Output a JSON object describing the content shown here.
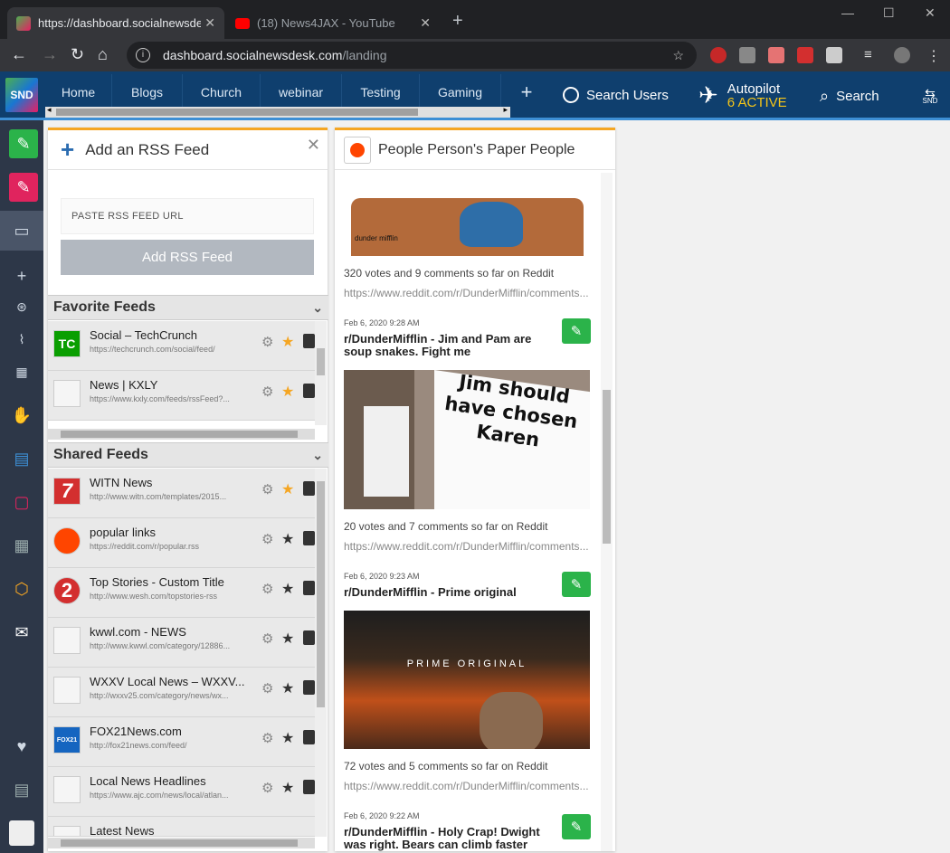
{
  "browser": {
    "tabs": [
      {
        "title": "https://dashboard.socialnewsdesk"
      },
      {
        "title": "(18) News4JAX - YouTube"
      }
    ],
    "url_host": "dashboard.socialnewsdesk.com",
    "url_path": "/landing"
  },
  "app": {
    "logo": "SND",
    "nav_tabs": [
      "Home",
      "Blogs",
      "Church",
      "webinar",
      "Testing",
      "Gaming"
    ],
    "search_users": "Search Users",
    "autopilot": "Autopilot",
    "autopilot_status": "6 ACTIVE",
    "search": "Search",
    "snd_badge": "SND"
  },
  "rss_panel": {
    "title": "Add an RSS Feed",
    "input_placeholder": "PASTE RSS FEED URL",
    "add_button": "Add RSS Feed",
    "favorite_header": "Favorite Feeds",
    "favorites": [
      {
        "title": "Social – TechCrunch",
        "url": "https://techcrunch.com/social/feed/",
        "icon": "TC"
      },
      {
        "title": "News | KXLY",
        "url": "https://www.kxly.com/feeds/rssFeed?..."
      }
    ],
    "shared_header": "Shared Feeds",
    "shared": [
      {
        "title": "WITN News",
        "url": "http://www.witn.com/templates/2015...",
        "icon": "7"
      },
      {
        "title": "popular links",
        "url": "https://reddit.com/r/popular.rss"
      },
      {
        "title": "Top Stories - Custom Title",
        "url": "http://www.wesh.com/topstories-rss",
        "icon": "2"
      },
      {
        "title": "kwwl.com - NEWS",
        "url": "http://www.kwwl.com/category/12886..."
      },
      {
        "title": "WXXV Local News – WXXV...",
        "url": "http://wxxv25.com/category/news/wx..."
      },
      {
        "title": "FOX21News.com",
        "url": "http://fox21news.com/feed/",
        "icon": "FOX21"
      },
      {
        "title": "Local News Headlines",
        "url": "https://www.ajc.com/news/local/atlan..."
      },
      {
        "title": "Latest News",
        "url": ""
      }
    ]
  },
  "feed_panel": {
    "title": "People Person's Paper People",
    "image_top_caption": "dunder mifflin",
    "posts": [
      {
        "stats": "320 votes and 9 comments so far on Reddit",
        "link": "https://www.reddit.com/r/DunderMifflin/comments..."
      },
      {
        "date": "Feb 6, 2020 9:28 AM",
        "title": "r/DunderMifflin - Jim and Pam are soup snakes. Fight me",
        "image_text": "Jim should have chosen Karen",
        "stats": "20 votes and 7 comments so far on Reddit",
        "link": "https://www.reddit.com/r/DunderMifflin/comments..."
      },
      {
        "date": "Feb 6, 2020 9:23 AM",
        "title": "r/DunderMifflin - Prime original",
        "image_text": "PRIME ORIGINAL",
        "stats": "72 votes and 5 comments so far on Reddit",
        "link": "https://www.reddit.com/r/DunderMifflin/comments..."
      },
      {
        "date": "Feb 6, 2020 9:22 AM",
        "title": "r/DunderMifflin - Holy Crap! Dwight was right. Bears can climb faster"
      }
    ]
  }
}
